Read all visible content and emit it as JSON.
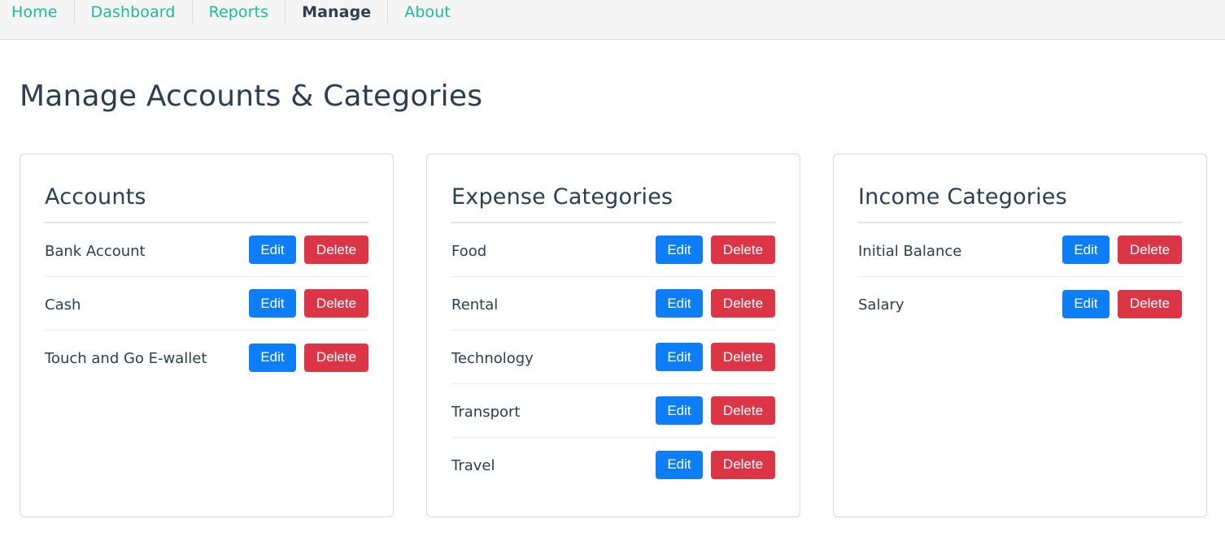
{
  "nav": {
    "items": [
      {
        "label": "Home",
        "active": false
      },
      {
        "label": "Dashboard",
        "active": false
      },
      {
        "label": "Reports",
        "active": false
      },
      {
        "label": "Manage",
        "active": true
      },
      {
        "label": "About",
        "active": false
      }
    ]
  },
  "page": {
    "title": "Manage Accounts & Categories"
  },
  "colors": {
    "nav_link": "#18bc9c",
    "text": "#2c3e50",
    "edit_button": "#0d7ef8",
    "delete_button": "#dc3545"
  },
  "buttons": {
    "edit_label": "Edit",
    "delete_label": "Delete"
  },
  "cards": [
    {
      "title": "Accounts",
      "items": [
        "Bank Account",
        "Cash",
        "Touch and Go E-wallet"
      ]
    },
    {
      "title": "Expense Categories",
      "items": [
        "Food",
        "Rental",
        "Technology",
        "Transport",
        "Travel"
      ]
    },
    {
      "title": "Income Categories",
      "items": [
        "Initial Balance",
        "Salary"
      ]
    }
  ]
}
